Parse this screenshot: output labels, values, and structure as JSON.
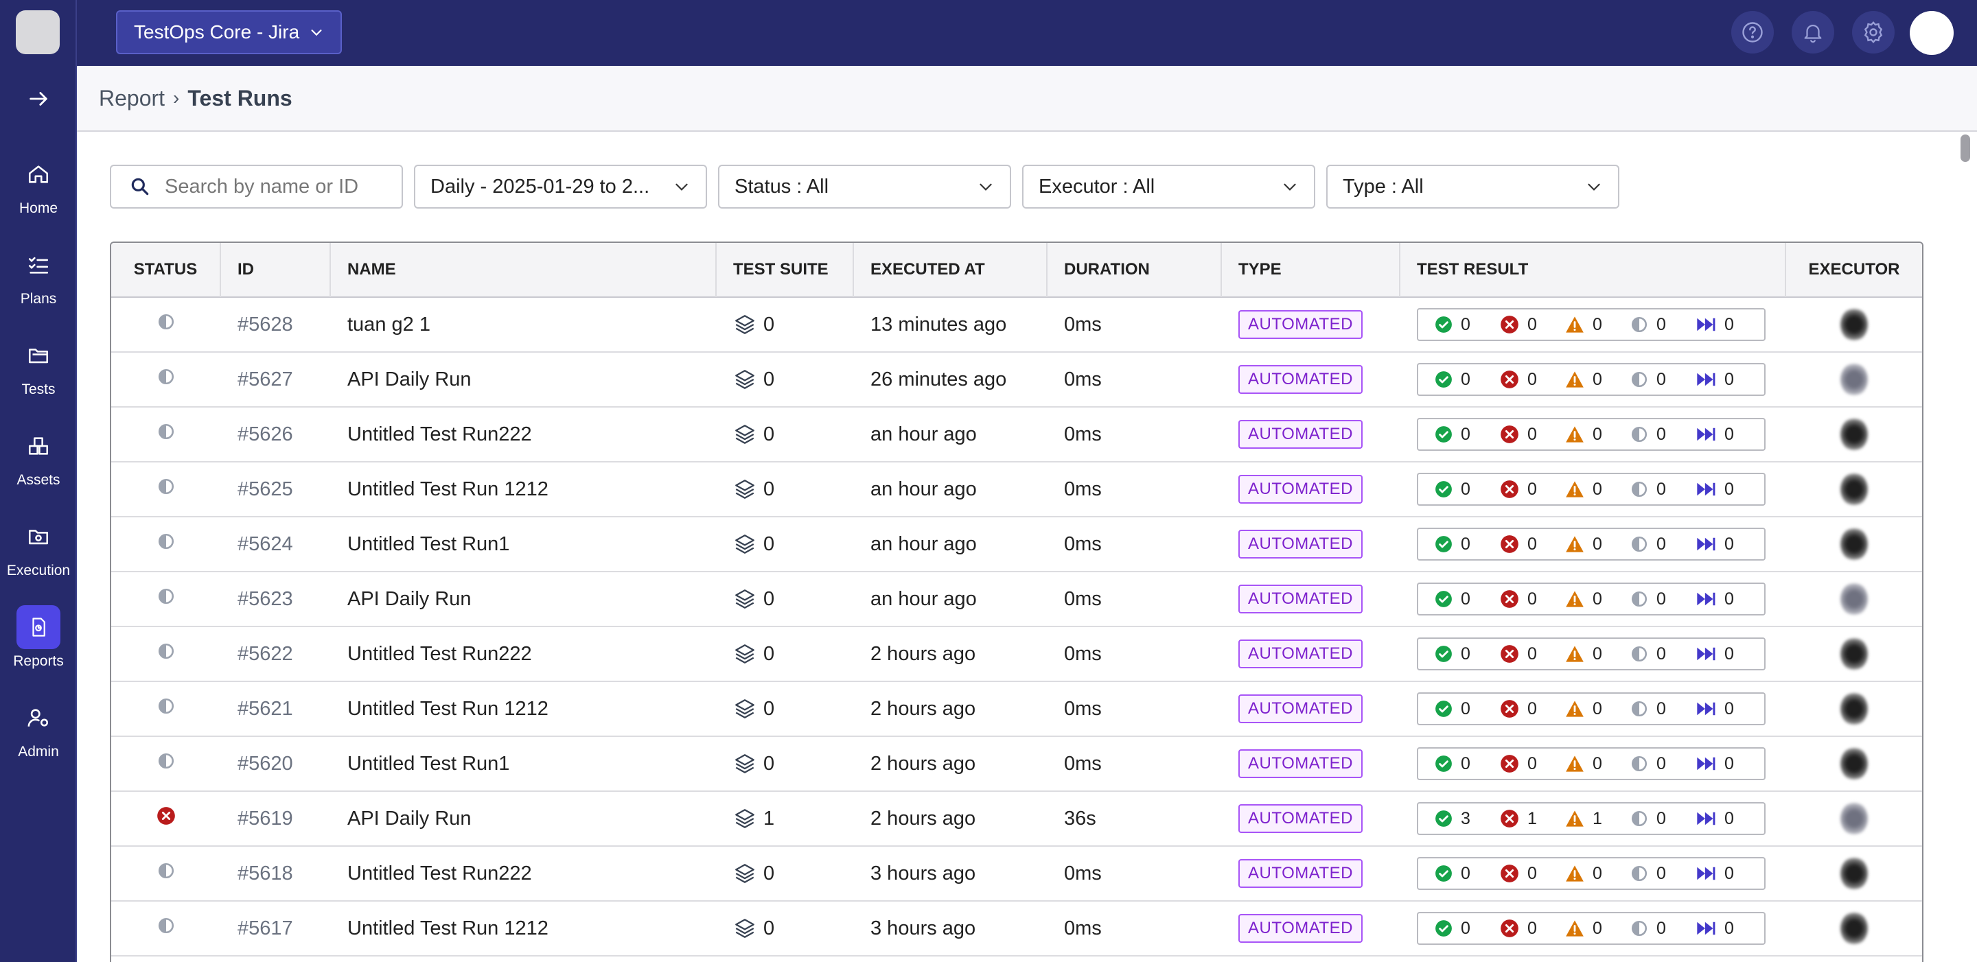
{
  "project": {
    "name": "TestOps Core - Jira"
  },
  "sidebar": {
    "items": [
      {
        "label": "Home",
        "icon": "home-icon"
      },
      {
        "label": "Plans",
        "icon": "plans-icon"
      },
      {
        "label": "Tests",
        "icon": "folder-icon"
      },
      {
        "label": "Assets",
        "icon": "assets-icon"
      },
      {
        "label": "Execution",
        "icon": "execution-icon"
      },
      {
        "label": "Reports",
        "icon": "report-icon",
        "active": true
      },
      {
        "label": "Admin",
        "icon": "admin-icon"
      }
    ]
  },
  "breadcrumb": {
    "parent": "Report",
    "current": "Test Runs"
  },
  "filters": {
    "search_placeholder": "Search by name or ID",
    "date": "Daily - 2025-01-29 to 2...",
    "status": "Status : All",
    "executor": "Executor : All",
    "type": "Type : All"
  },
  "table": {
    "headers": [
      "STATUS",
      "ID",
      "NAME",
      "TEST SUITE",
      "EXECUTED AT",
      "DURATION",
      "TYPE",
      "TEST RESULT",
      "EXECUTOR"
    ],
    "rows": [
      {
        "status": "incomplete",
        "id": "#5628",
        "name": "tuan g2 1",
        "suite": "0",
        "executed": "13 minutes ago",
        "duration": "0ms",
        "type": "AUTOMATED",
        "passed": "0",
        "failed": "0",
        "error": "0",
        "incomplete": "0",
        "skipped": "0",
        "avatar": "dark"
      },
      {
        "status": "incomplete",
        "id": "#5627",
        "name": "API Daily Run",
        "suite": "0",
        "executed": "26 minutes ago",
        "duration": "0ms",
        "type": "AUTOMATED",
        "passed": "0",
        "failed": "0",
        "error": "0",
        "incomplete": "0",
        "skipped": "0",
        "avatar": "light"
      },
      {
        "status": "incomplete",
        "id": "#5626",
        "name": "Untitled Test Run222",
        "suite": "0",
        "executed": "an hour ago",
        "duration": "0ms",
        "type": "AUTOMATED",
        "passed": "0",
        "failed": "0",
        "error": "0",
        "incomplete": "0",
        "skipped": "0",
        "avatar": "dark"
      },
      {
        "status": "incomplete",
        "id": "#5625",
        "name": "Untitled Test Run 1212",
        "suite": "0",
        "executed": "an hour ago",
        "duration": "0ms",
        "type": "AUTOMATED",
        "passed": "0",
        "failed": "0",
        "error": "0",
        "incomplete": "0",
        "skipped": "0",
        "avatar": "dark"
      },
      {
        "status": "incomplete",
        "id": "#5624",
        "name": "Untitled Test Run1",
        "suite": "0",
        "executed": "an hour ago",
        "duration": "0ms",
        "type": "AUTOMATED",
        "passed": "0",
        "failed": "0",
        "error": "0",
        "incomplete": "0",
        "skipped": "0",
        "avatar": "dark"
      },
      {
        "status": "incomplete",
        "id": "#5623",
        "name": "API Daily Run",
        "suite": "0",
        "executed": "an hour ago",
        "duration": "0ms",
        "type": "AUTOMATED",
        "passed": "0",
        "failed": "0",
        "error": "0",
        "incomplete": "0",
        "skipped": "0",
        "avatar": "light"
      },
      {
        "status": "incomplete",
        "id": "#5622",
        "name": "Untitled Test Run222",
        "suite": "0",
        "executed": "2 hours ago",
        "duration": "0ms",
        "type": "AUTOMATED",
        "passed": "0",
        "failed": "0",
        "error": "0",
        "incomplete": "0",
        "skipped": "0",
        "avatar": "dark"
      },
      {
        "status": "incomplete",
        "id": "#5621",
        "name": "Untitled Test Run 1212",
        "suite": "0",
        "executed": "2 hours ago",
        "duration": "0ms",
        "type": "AUTOMATED",
        "passed": "0",
        "failed": "0",
        "error": "0",
        "incomplete": "0",
        "skipped": "0",
        "avatar": "dark"
      },
      {
        "status": "incomplete",
        "id": "#5620",
        "name": "Untitled Test Run1",
        "suite": "0",
        "executed": "2 hours ago",
        "duration": "0ms",
        "type": "AUTOMATED",
        "passed": "0",
        "failed": "0",
        "error": "0",
        "incomplete": "0",
        "skipped": "0",
        "avatar": "dark"
      },
      {
        "status": "failed",
        "id": "#5619",
        "name": "API Daily Run",
        "suite": "1",
        "executed": "2 hours ago",
        "duration": "36s",
        "type": "AUTOMATED",
        "passed": "3",
        "failed": "1",
        "error": "1",
        "incomplete": "0",
        "skipped": "0",
        "avatar": "light"
      },
      {
        "status": "incomplete",
        "id": "#5618",
        "name": "Untitled Test Run222",
        "suite": "0",
        "executed": "3 hours ago",
        "duration": "0ms",
        "type": "AUTOMATED",
        "passed": "0",
        "failed": "0",
        "error": "0",
        "incomplete": "0",
        "skipped": "0",
        "avatar": "dark"
      },
      {
        "status": "incomplete",
        "id": "#5617",
        "name": "Untitled Test Run 1212",
        "suite": "0",
        "executed": "3 hours ago",
        "duration": "0ms",
        "type": "AUTOMATED",
        "passed": "0",
        "failed": "0",
        "error": "0",
        "incomplete": "0",
        "skipped": "0",
        "avatar": "dark"
      }
    ]
  },
  "colors": {
    "nav_bg": "#262a6b",
    "active_nav": "#4f46e5",
    "passed": "#16a34a",
    "failed": "#b91c1c",
    "error": "#d97706",
    "incomplete": "#9ca3af",
    "skipped": "#4338ca",
    "badge": "#a855f7"
  }
}
